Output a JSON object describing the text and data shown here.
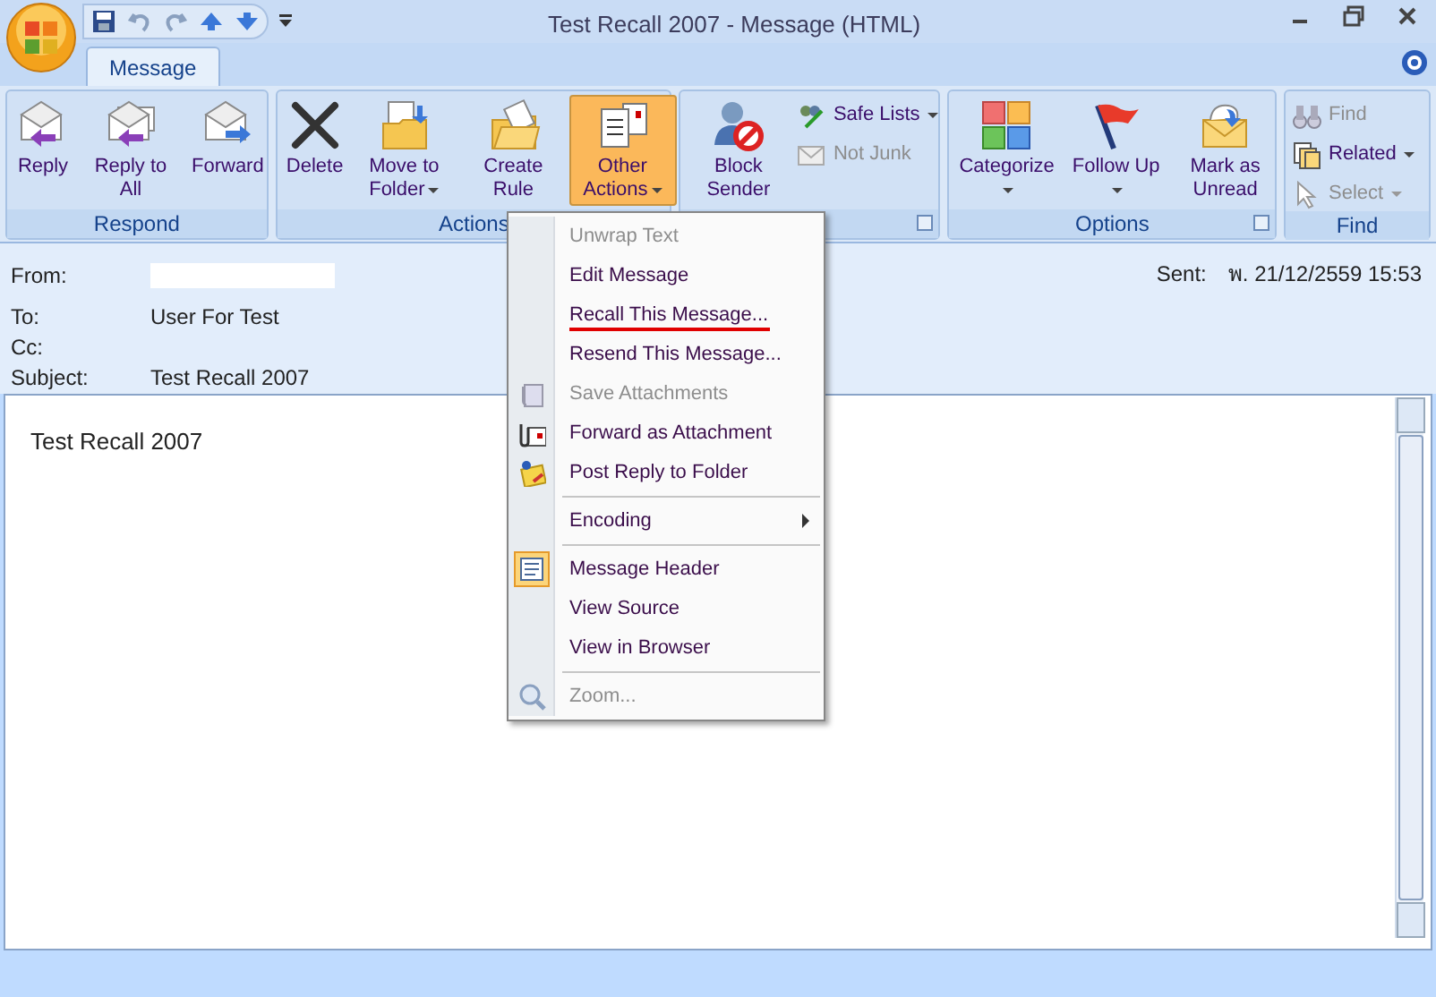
{
  "window": {
    "title": "Test Recall 2007 - Message (HTML)"
  },
  "tabs": [
    {
      "label": "Message",
      "selected": true
    }
  ],
  "ribbon_groups": [
    {
      "label": "Respond",
      "launcher": false,
      "buttons": [
        {
          "kind": "big",
          "label": "Reply",
          "dropdown": false,
          "disabled": false,
          "active": false
        },
        {
          "kind": "big",
          "label": "Reply to All",
          "dropdown": false,
          "disabled": false,
          "active": false
        },
        {
          "kind": "big",
          "label": "Forward",
          "dropdown": false,
          "disabled": false,
          "active": false
        }
      ]
    },
    {
      "label": "Actions",
      "launcher": false,
      "buttons": [
        {
          "kind": "big",
          "label": "Delete",
          "dropdown": false,
          "disabled": false,
          "active": false
        },
        {
          "kind": "big",
          "label": "Move to Folder",
          "dropdown": true,
          "disabled": false,
          "active": false
        },
        {
          "kind": "big",
          "label": "Create Rule",
          "dropdown": false,
          "disabled": false,
          "active": false
        },
        {
          "kind": "big",
          "label": "Other Actions",
          "dropdown": true,
          "disabled": false,
          "active": true
        }
      ]
    },
    {
      "launcher": true,
      "buttons": [
        {
          "kind": "big",
          "label": "Block Sender",
          "dropdown": false,
          "disabled": false,
          "active": false
        },
        {
          "kind": "small",
          "label": "Safe Lists",
          "dropdown": true,
          "disabled": false,
          "active": false
        },
        {
          "kind": "small",
          "label": "Not Junk",
          "dropdown": false,
          "disabled": true,
          "active": false
        }
      ]
    },
    {
      "label": "Options",
      "launcher": true,
      "buttons": [
        {
          "kind": "big",
          "label": "Categorize",
          "dropdown": true,
          "disabled": false,
          "active": false
        },
        {
          "kind": "big",
          "label": "Follow Up",
          "dropdown": true,
          "disabled": false,
          "active": false
        },
        {
          "kind": "big",
          "label": "Mark as Unread",
          "dropdown": false,
          "disabled": false,
          "active": false
        }
      ]
    },
    {
      "label": "Find",
      "launcher": false,
      "buttons": [
        {
          "kind": "small",
          "label": "Find",
          "dropdown": false,
          "disabled": true,
          "active": false
        },
        {
          "kind": "small",
          "label": "Related",
          "dropdown": true,
          "disabled": false,
          "active": false
        },
        {
          "kind": "small",
          "label": "Select",
          "dropdown": true,
          "disabled": true,
          "active": false
        }
      ]
    }
  ],
  "header": {
    "fields": [
      {
        "label": "From:"
      },
      {
        "label": "To:",
        "value": "User For Test"
      },
      {
        "label": "Cc:"
      },
      {
        "label": "Subject:",
        "value": "Test Recall 2007"
      }
    ],
    "sent": {
      "label": "Sent:",
      "value": "พ. 21/12/2559 15:53"
    }
  },
  "body": {
    "text": "Test Recall 2007"
  },
  "menu": {
    "items": [
      {
        "kind": "item",
        "label": "Unwrap Text",
        "disabled": true,
        "checked": false,
        "annotated": false
      },
      {
        "kind": "item",
        "label": "Edit Message",
        "disabled": false,
        "checked": false,
        "annotated": false
      },
      {
        "kind": "item",
        "label": "Recall This Message...",
        "disabled": false,
        "checked": false,
        "annotated": true
      },
      {
        "kind": "item",
        "label": "Resend This Message...",
        "disabled": false,
        "checked": false,
        "annotated": false
      },
      {
        "kind": "item",
        "label": "Save Attachments",
        "disabled": true,
        "checked": false,
        "annotated": false
      },
      {
        "kind": "item",
        "label": "Forward as Attachment",
        "disabled": false,
        "checked": false,
        "annotated": false
      },
      {
        "kind": "item",
        "label": "Post Reply to Folder",
        "disabled": false,
        "checked": false,
        "annotated": false
      },
      {
        "kind": "separator"
      },
      {
        "kind": "submenu",
        "label": "Encoding",
        "disabled": false,
        "checked": false,
        "annotated": false
      },
      {
        "kind": "separator"
      },
      {
        "kind": "item",
        "label": "Message Header",
        "disabled": false,
        "checked": true,
        "annotated": false
      },
      {
        "kind": "item",
        "label": "View Source",
        "disabled": false,
        "checked": false,
        "annotated": false
      },
      {
        "kind": "item",
        "label": "View in Browser",
        "disabled": false,
        "checked": false,
        "annotated": false
      },
      {
        "kind": "separator"
      },
      {
        "kind": "item",
        "label": "Zoom...",
        "disabled": true,
        "checked": false,
        "annotated": false
      }
    ]
  }
}
